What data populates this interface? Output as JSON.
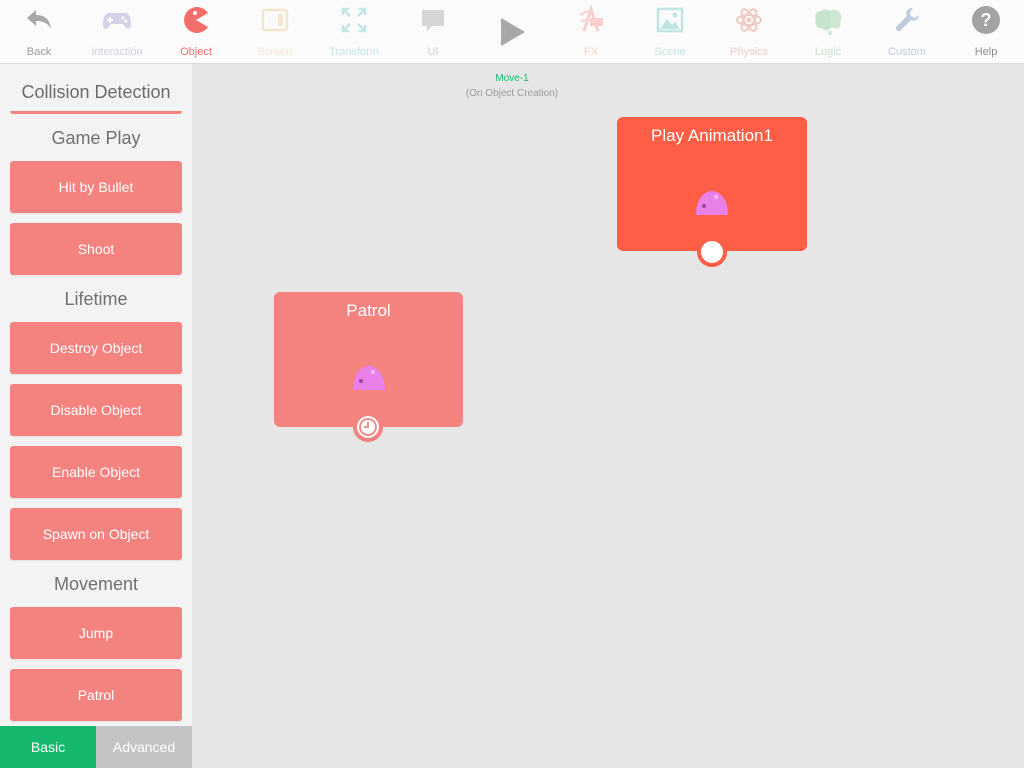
{
  "toolbar": {
    "items": [
      {
        "label": "Back",
        "icon": "back-arrow-icon"
      },
      {
        "label": "Interaction",
        "icon": "gamepad-icon"
      },
      {
        "label": "Object",
        "icon": "pacman-icon"
      },
      {
        "label": "Screen",
        "icon": "screen-icon"
      },
      {
        "label": "Transform",
        "icon": "transform-icon"
      },
      {
        "label": "UI",
        "icon": "speech-bubble-icon"
      },
      {
        "label": "FX",
        "icon": "fx-icon"
      },
      {
        "label": "Scene",
        "icon": "landscape-icon"
      },
      {
        "label": "Physics",
        "icon": "atom-icon"
      },
      {
        "label": "Logic",
        "icon": "brain-icon"
      },
      {
        "label": "Custom",
        "icon": "wrench-icon"
      },
      {
        "label": "Help",
        "icon": "help-icon"
      }
    ],
    "play_icon": "play-icon"
  },
  "sidebar": {
    "title": "Collision Detection",
    "sections": [
      {
        "heading": "Game Play",
        "actions": [
          "Hit by Bullet",
          "Shoot"
        ]
      },
      {
        "heading": "Lifetime",
        "actions": [
          "Destroy Object",
          "Disable Object",
          "Enable Object",
          "Spawn on Object"
        ]
      },
      {
        "heading": "Movement",
        "actions": [
          "Jump",
          "Patrol"
        ]
      }
    ]
  },
  "mode_tabs": {
    "basic": "Basic",
    "advanced": "Advanced"
  },
  "canvas": {
    "title": "Move-1",
    "subtitle": "(On Object Creation)",
    "nodes": [
      {
        "title": "Play Animation1",
        "color": "#fe5e45"
      },
      {
        "title": "Patrol",
        "color": "#f4837f"
      }
    ]
  },
  "colors": {
    "accent_red": "#f4837f",
    "active_node": "#fe5e45",
    "green": "#15b86c",
    "blob_purple": "#e97fe8"
  }
}
